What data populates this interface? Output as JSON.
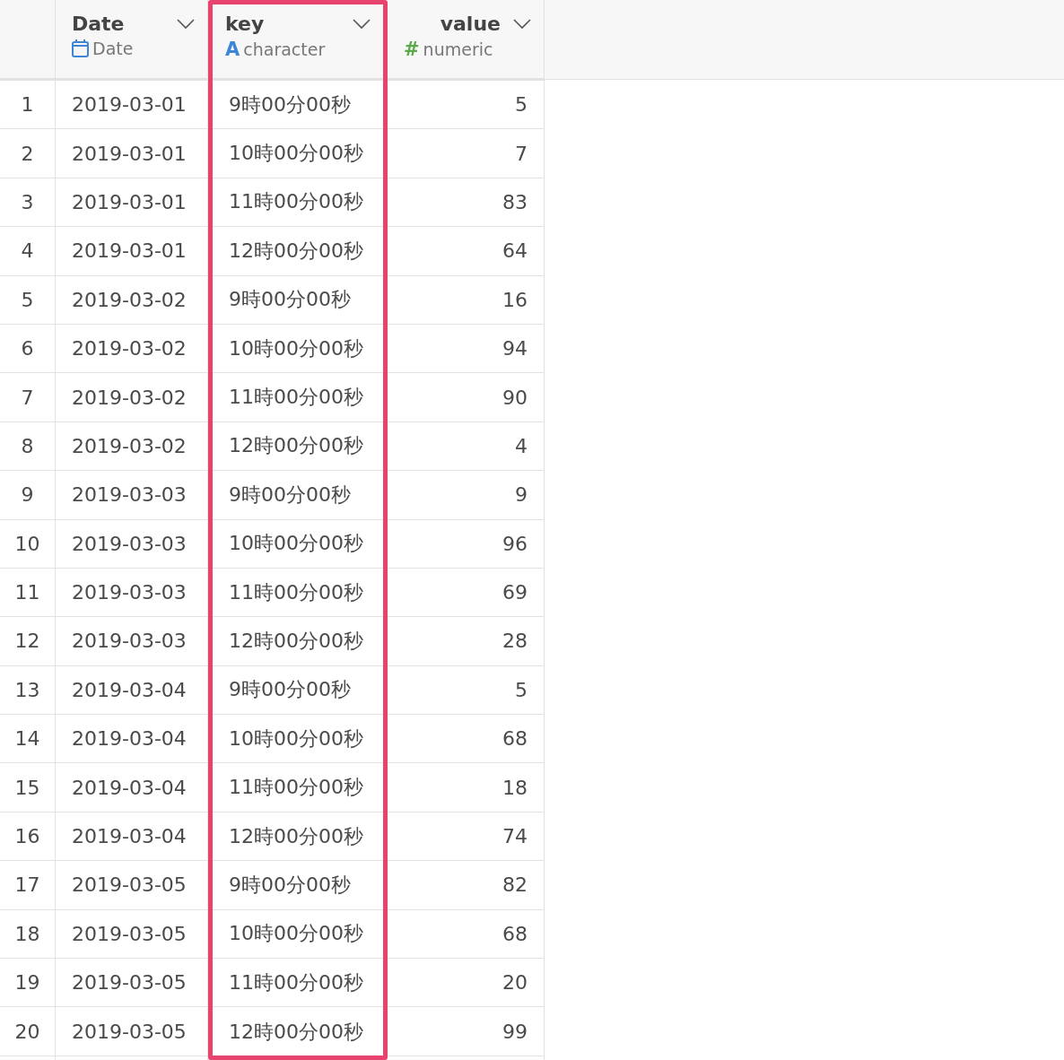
{
  "table": {
    "columns": [
      {
        "name": "Date",
        "kind": "date",
        "type_label": "Date",
        "highlighted": false
      },
      {
        "name": "key",
        "kind": "character",
        "type_symbol": "A",
        "type_label": "character",
        "highlighted": true
      },
      {
        "name": "value",
        "kind": "numeric",
        "type_symbol": "#",
        "type_label": "numeric",
        "highlighted": false
      }
    ],
    "rows": [
      {
        "n": "1",
        "cells": [
          "2019-03-01",
          "9時00分00秒",
          "5"
        ]
      },
      {
        "n": "2",
        "cells": [
          "2019-03-01",
          "10時00分00秒",
          "7"
        ]
      },
      {
        "n": "3",
        "cells": [
          "2019-03-01",
          "11時00分00秒",
          "83"
        ]
      },
      {
        "n": "4",
        "cells": [
          "2019-03-01",
          "12時00分00秒",
          "64"
        ]
      },
      {
        "n": "5",
        "cells": [
          "2019-03-02",
          "9時00分00秒",
          "16"
        ]
      },
      {
        "n": "6",
        "cells": [
          "2019-03-02",
          "10時00分00秒",
          "94"
        ]
      },
      {
        "n": "7",
        "cells": [
          "2019-03-02",
          "11時00分00秒",
          "90"
        ]
      },
      {
        "n": "8",
        "cells": [
          "2019-03-02",
          "12時00分00秒",
          "4"
        ]
      },
      {
        "n": "9",
        "cells": [
          "2019-03-03",
          "9時00分00秒",
          "9"
        ]
      },
      {
        "n": "10",
        "cells": [
          "2019-03-03",
          "10時00分00秒",
          "96"
        ]
      },
      {
        "n": "11",
        "cells": [
          "2019-03-03",
          "11時00分00秒",
          "69"
        ]
      },
      {
        "n": "12",
        "cells": [
          "2019-03-03",
          "12時00分00秒",
          "28"
        ]
      },
      {
        "n": "13",
        "cells": [
          "2019-03-04",
          "9時00分00秒",
          "5"
        ]
      },
      {
        "n": "14",
        "cells": [
          "2019-03-04",
          "10時00分00秒",
          "68"
        ]
      },
      {
        "n": "15",
        "cells": [
          "2019-03-04",
          "11時00分00秒",
          "18"
        ]
      },
      {
        "n": "16",
        "cells": [
          "2019-03-04",
          "12時00分00秒",
          "74"
        ]
      },
      {
        "n": "17",
        "cells": [
          "2019-03-05",
          "9時00分00秒",
          "82"
        ]
      },
      {
        "n": "18",
        "cells": [
          "2019-03-05",
          "10時00分00秒",
          "68"
        ]
      },
      {
        "n": "19",
        "cells": [
          "2019-03-05",
          "11時00分00秒",
          "20"
        ]
      },
      {
        "n": "20",
        "cells": [
          "2019-03-05",
          "12時00分00秒",
          "99"
        ]
      }
    ]
  }
}
